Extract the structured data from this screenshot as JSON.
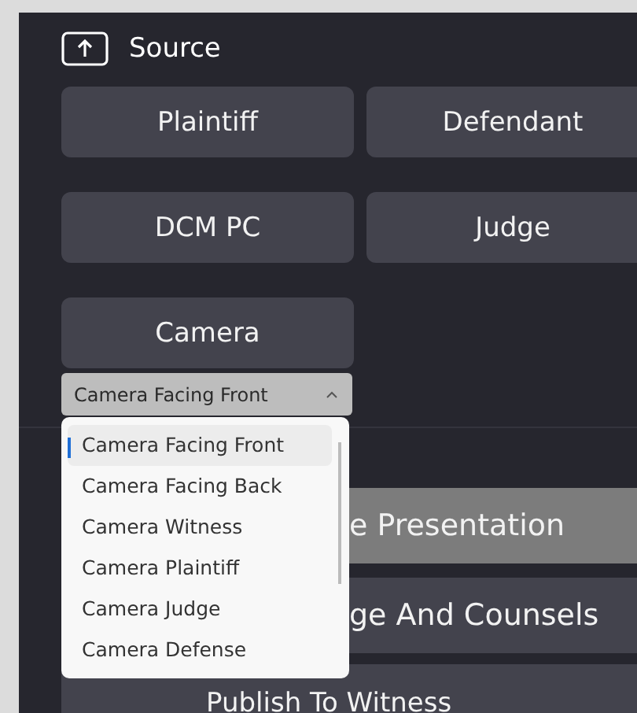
{
  "header": {
    "title": "Source"
  },
  "sources": [
    {
      "label": "Plaintiff"
    },
    {
      "label": "Defendant"
    },
    {
      "label": "DCM PC"
    },
    {
      "label": "Judge"
    },
    {
      "label": "Camera"
    }
  ],
  "camera_select": {
    "value": "Camera Facing Front",
    "expanded": true
  },
  "camera_options": [
    {
      "label": "Camera Facing Front",
      "selected": true
    },
    {
      "label": "Camera Facing Back",
      "selected": false
    },
    {
      "label": "Camera Witness",
      "selected": false
    },
    {
      "label": "Camera Plaintiff",
      "selected": false
    },
    {
      "label": "Camera Judge",
      "selected": false
    },
    {
      "label": "Camera Defense",
      "selected": false
    }
  ],
  "actions": [
    {
      "label": "e Presentation",
      "active": true
    },
    {
      "label": "ge And Counsels",
      "active": false
    },
    {
      "label": "Publish To Witness",
      "active": false
    }
  ]
}
